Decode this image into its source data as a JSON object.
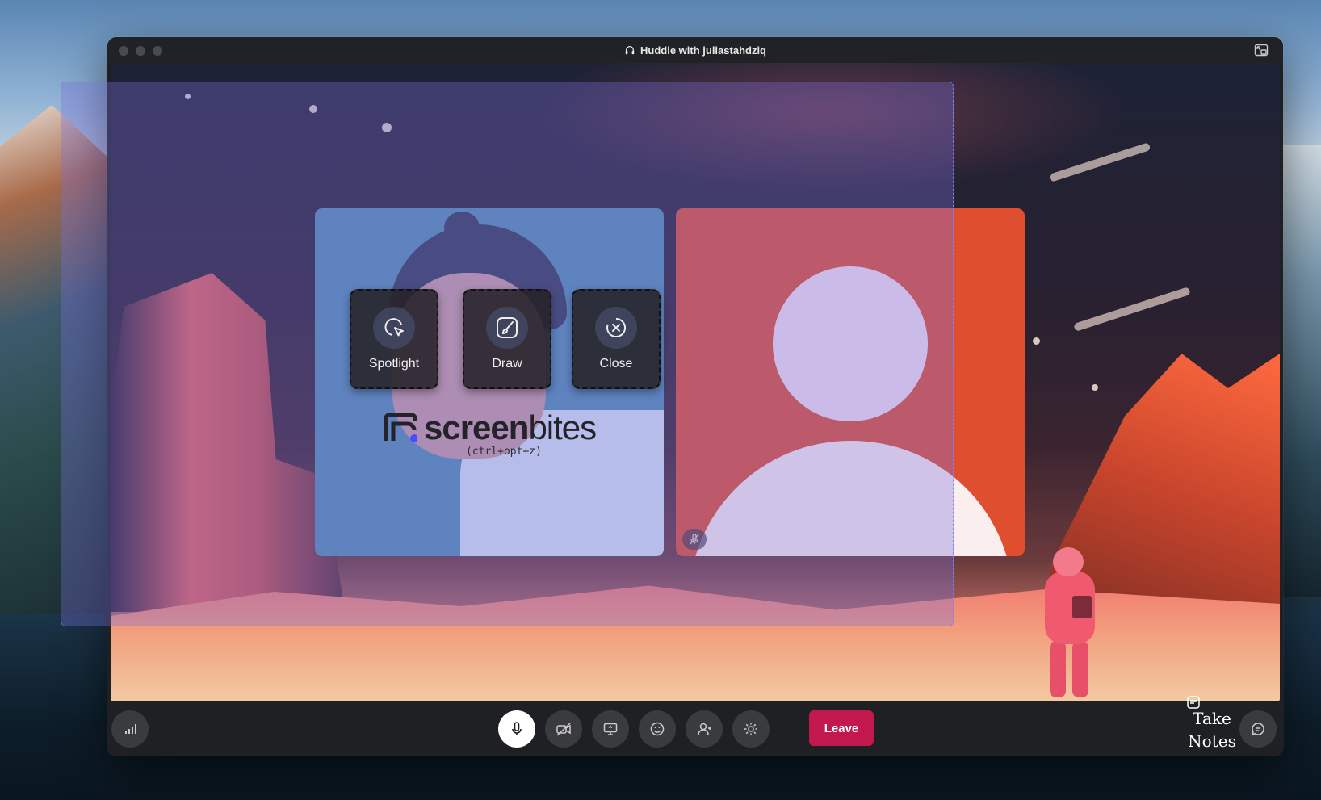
{
  "window": {
    "title": "Huddle with juliastahdziq"
  },
  "tiles": {
    "screenshare": {
      "brand_prefix": "screen",
      "brand_suffix": "bites",
      "shortcut": "(ctrl+opt+z)"
    },
    "participant": {
      "muted": true
    }
  },
  "annotation_tools": [
    {
      "label": "Spotlight",
      "icon": "spotlight-cursor-icon"
    },
    {
      "label": "Draw",
      "icon": "brush-icon"
    },
    {
      "label": "Close",
      "icon": "close-circle-icon"
    }
  ],
  "toolbar": {
    "leave_label": "Leave",
    "take_notes_label": "Take Notes",
    "buttons": [
      "signal-bars-icon",
      "microphone-icon",
      "camera-off-icon",
      "screen-share-icon",
      "emoji-icon",
      "invite-person-icon",
      "settings-gear-icon",
      "chat-thread-icon"
    ]
  },
  "colors": {
    "leave": "#c2184e",
    "selection_border": "#7d80ee",
    "selection_fill": "#7a70dc",
    "tile_left": "#4f8db0",
    "tile_right": "#de4e2f"
  }
}
